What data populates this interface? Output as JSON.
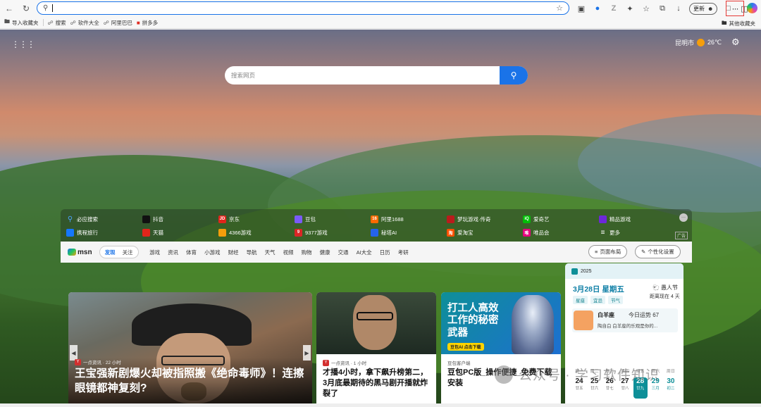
{
  "toolbar": {
    "address_value": "",
    "update_label": "更新"
  },
  "favorites": {
    "items": [
      {
        "label": "导入收藏夹"
      },
      {
        "label": "搜索"
      },
      {
        "label": "软件大全"
      },
      {
        "label": "阿里巴巴"
      },
      {
        "label": "拼多多"
      }
    ],
    "other_label": "其他收藏夹"
  },
  "weather": {
    "city": "昆明市",
    "temp": "26℃"
  },
  "search": {
    "placeholder": "搜索网页"
  },
  "quick_links": [
    {
      "label": "必应搜索",
      "icon": "search-icon",
      "color": "#1a73e8"
    },
    {
      "label": "抖音",
      "icon": "douyin-icon",
      "color": "#111111"
    },
    {
      "label": "京东",
      "icon": "jd-icon",
      "color": "#e1251b",
      "glyph": "JD"
    },
    {
      "label": "豆包",
      "icon": "doubao-icon",
      "color": "#7a5af8"
    },
    {
      "label": "阿里1688",
      "icon": "ali1688-icon",
      "color": "#ff6a00",
      "glyph": "1688"
    },
    {
      "label": "梦玩游戏·传奇",
      "icon": "game-icon",
      "color": "#b91c1c"
    },
    {
      "label": "爱奇艺",
      "icon": "iqiyi-icon",
      "color": "#00be06",
      "glyph": "iQ"
    },
    {
      "label": "精品游戏",
      "icon": "gamepad-icon",
      "color": "#6d28d9"
    },
    {
      "label": "携程旅行",
      "icon": "ctrip-icon",
      "color": "#1677ff"
    },
    {
      "label": "天猫",
      "icon": "tmall-icon",
      "color": "#e1251b"
    },
    {
      "label": "4366游戏",
      "icon": "4366-icon",
      "color": "#f59e0b"
    },
    {
      "label": "9377游戏",
      "icon": "9377-icon",
      "color": "#dc2626",
      "glyph": "9"
    },
    {
      "label": "秘塔AI",
      "icon": "metaso-icon",
      "color": "#2563eb"
    },
    {
      "label": "爱淘宝",
      "icon": "taobao-icon",
      "color": "#ff5000",
      "glyph": "淘"
    },
    {
      "label": "唯品会",
      "icon": "vip-icon",
      "color": "#e6007e",
      "glyph": "唯"
    },
    {
      "label": "更多",
      "icon": "more-list-icon",
      "color": "#ffffff"
    }
  ],
  "quick_ad_label": "广告",
  "msn": {
    "logo": "msn",
    "tabs": [
      "发现",
      "关注"
    ],
    "categories": [
      "游戏",
      "资讯",
      "体育",
      "小游戏",
      "财经",
      "导航",
      "天气",
      "视频",
      "购物",
      "健康",
      "交通",
      "AI大全",
      "日历",
      "考研"
    ],
    "layout_label": "页面布局",
    "customize_label": "个性化设置"
  },
  "cards": {
    "main": {
      "source": "一点资讯 · 22 小时",
      "headline": "王宝强新剧爆火却被指照搬《绝命毒师》！连擦眼镜都神复刻?"
    },
    "middle": {
      "source": "一点资讯 · 1 小时",
      "headline": "才播4小时，拿下飙升榜第二，3月底最期待的黑马剧开播就炸裂了"
    },
    "ai": {
      "banner_text": "打工人高效工作的秘密武器",
      "badge": "豆包AI 点击下载",
      "source": "豆包客户端",
      "headline": "豆包PC版_操作便捷_免费下载安装"
    }
  },
  "calendar": {
    "year": "2025",
    "date": "3月28日 星期五",
    "holiday": "愚人节",
    "countdown": "距离现在 4 天",
    "tags": [
      "星座",
      "宜忌",
      "节气"
    ],
    "zodiac": {
      "name": "白羊座",
      "fortune": "今日运势 67",
      "line": "陶自白 白羊座的乐观是你的..."
    },
    "weekdays": [
      "周一",
      "周二",
      "周三",
      "周四",
      "周五",
      "周六",
      "周日"
    ],
    "days": [
      {
        "num": "24",
        "sub": "廿五"
      },
      {
        "num": "25",
        "sub": "廿六"
      },
      {
        "num": "26",
        "sub": "廿七"
      },
      {
        "num": "27",
        "sub": "廿八"
      },
      {
        "num": "28",
        "sub": "廿九"
      },
      {
        "num": "29",
        "sub": "三月"
      },
      {
        "num": "30",
        "sub": "初二"
      }
    ]
  },
  "watermark": "公众号 · 学习软件知识"
}
